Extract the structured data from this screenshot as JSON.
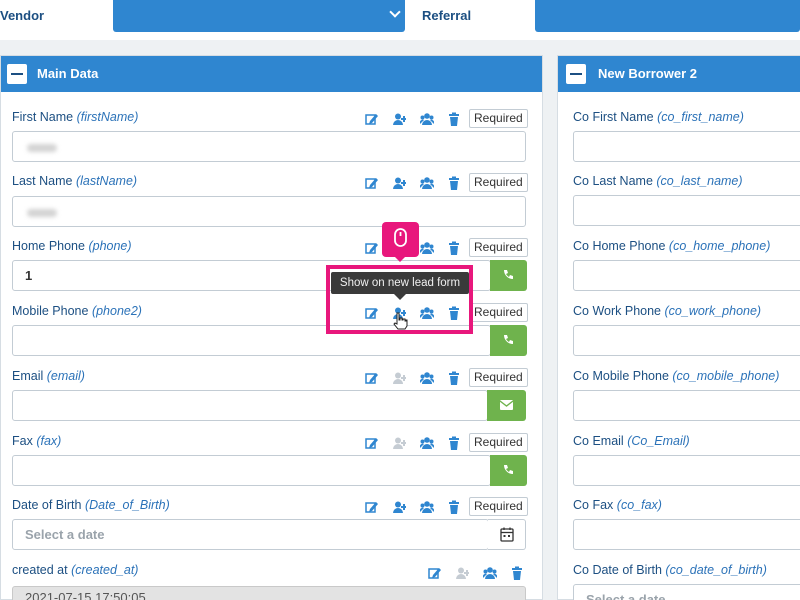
{
  "top_bar": {
    "vendor_label": "Vendor",
    "referral_label": "Referral"
  },
  "main_panel": {
    "title": "Main Data",
    "required_label": "Required",
    "fields": {
      "first_name": {
        "label": "First Name",
        "key": "(firstName)"
      },
      "last_name": {
        "label": "Last Name",
        "key": "(lastName)"
      },
      "home_phone": {
        "label": "Home Phone",
        "key": "(phone)",
        "value": "1"
      },
      "mobile_phone": {
        "label": "Mobile Phone",
        "key": "(phone2)"
      },
      "email": {
        "label": "Email",
        "key": "(email)"
      },
      "fax": {
        "label": "Fax",
        "key": "(fax)"
      },
      "dob": {
        "label": "Date of Birth",
        "key": "(Date_of_Birth)",
        "placeholder": "Select a date"
      },
      "created_at": {
        "label": "created at",
        "key": "(created_at)",
        "value": "2021-07-15 17:50:05"
      }
    }
  },
  "borrower_panel": {
    "title": "New Borrower 2",
    "fields": [
      {
        "label": "Co First Name",
        "key": "(co_first_name)"
      },
      {
        "label": "Co Last Name",
        "key": "(co_last_name)"
      },
      {
        "label": "Co Home Phone",
        "key": "(co_home_phone)"
      },
      {
        "label": "Co Work Phone",
        "key": "(co_work_phone)"
      },
      {
        "label": "Co Mobile Phone",
        "key": "(co_mobile_phone)"
      },
      {
        "label": "Co Email",
        "key": "(Co_Email)"
      },
      {
        "label": "Co Fax",
        "key": "(co_fax)"
      },
      {
        "label": "Co Date of Birth",
        "key": "(co_date_of_birth)"
      }
    ],
    "dob_placeholder": "Select a date"
  },
  "tooltip": {
    "text": "Show on new lead form"
  },
  "icons": {
    "edit": "edit-icon",
    "add_user": "add-user-icon",
    "group": "group-icon",
    "delete": "trash-icon",
    "phone": "phone-icon",
    "envelope": "envelope-icon",
    "calendar": "calendar-icon",
    "mouse": "mouse-icon"
  },
  "colors": {
    "accent": "#2f86d0",
    "label": "#1c4f82",
    "green": "#6fb34d",
    "highlight": "#e8177c"
  }
}
